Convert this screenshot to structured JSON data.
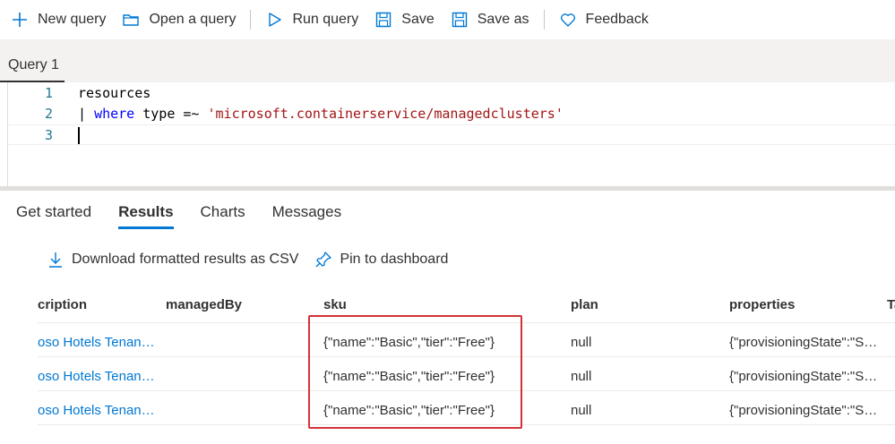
{
  "toolbar": {
    "new_query": "New query",
    "open_query": "Open a query",
    "run_query": "Run query",
    "save": "Save",
    "save_as": "Save as",
    "feedback": "Feedback"
  },
  "query_tab": {
    "label": "Query 1"
  },
  "editor": {
    "lines": [
      {
        "number": "1",
        "text": "resources"
      },
      {
        "number": "2",
        "pipe": "| ",
        "keyword": "where",
        "middle": " type =~ ",
        "string": "'microsoft.containerservice/managedclusters'"
      },
      {
        "number": "3",
        "text": ""
      }
    ]
  },
  "result_tabs": [
    "Get started",
    "Results",
    "Charts",
    "Messages"
  ],
  "active_result_tab": "Results",
  "actions": {
    "download": "Download formatted results as CSV",
    "pin": "Pin to dashboard"
  },
  "grid": {
    "columns": [
      "cription",
      "managedBy",
      "sku",
      "plan",
      "properties",
      "Ta"
    ],
    "rows": [
      [
        "oso Hotels Tenan…",
        "",
        "{\"name\":\"Basic\",\"tier\":\"Free\"}",
        "null",
        "{\"provisioningState\":\"S…"
      ],
      [
        "oso Hotels Tenan…",
        "",
        "{\"name\":\"Basic\",\"tier\":\"Free\"}",
        "null",
        "{\"provisioningState\":\"S…"
      ],
      [
        "oso Hotels Tenan…",
        "",
        "{\"name\":\"Basic\",\"tier\":\"Free\"}",
        "null",
        "{\"provisioningState\":\"S…"
      ]
    ]
  },
  "colors": {
    "accent": "#0078d4",
    "highlight": "#d13438"
  }
}
